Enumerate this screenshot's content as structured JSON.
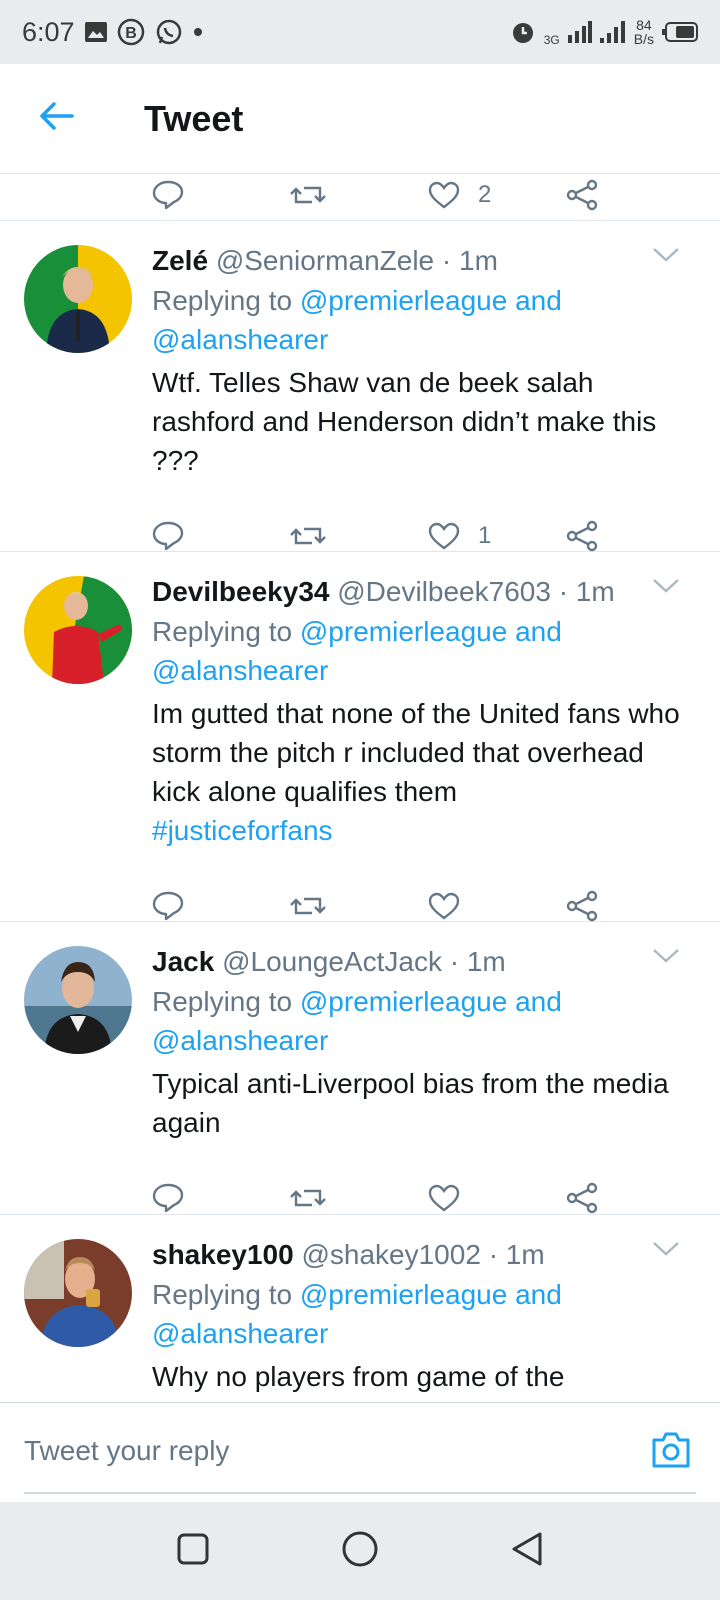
{
  "status_bar": {
    "time": "6:07",
    "network": "3G",
    "speed_value": "84",
    "speed_unit": "B/s"
  },
  "header": {
    "title": "Tweet"
  },
  "tweets": [
    {
      "name": "Zelé",
      "handle": "@SeniormanZele",
      "time": "· 1m",
      "reply_prefix": "Replying to",
      "reply_to_1": "@premierleague and",
      "reply_to_2": "@alanshearer",
      "text": "Wtf. Telles Shaw van de beek salah rashford and Henderson didn’t make this ???",
      "likes": "1"
    },
    {
      "name": "Devilbeeky34",
      "handle": "@Devilbeek7603",
      "time": "· 1m",
      "reply_prefix": "Replying to",
      "reply_to_1": "@premierleague and",
      "reply_to_2": "@alanshearer",
      "text": "Im gutted that none of the United fans who storm the pitch r included that overhead kick alone qualifies them",
      "hashtag": "#justiceforfans",
      "likes": ""
    },
    {
      "name": "Jack",
      "handle": "@LoungeActJack",
      "time": "· 1m",
      "reply_prefix": "Replying to",
      "reply_to_1": "@premierleague and",
      "reply_to_2": "@alanshearer",
      "text": "Typical anti-Liverpool bias from the media again",
      "likes": ""
    },
    {
      "name": "shakey100",
      "handle": "@shakey1002",
      "time": "· 1m",
      "reply_prefix": "Replying to",
      "reply_to_1": "@premierleague and",
      "reply_to_2": "@alanshearer",
      "text": "Why no players from game of the",
      "likes": ""
    }
  ],
  "partial_tweet": {
    "likes": "2"
  },
  "composer": {
    "placeholder": "Tweet your reply"
  },
  "icons": {
    "back": "back-arrow-icon",
    "reply": "reply-icon",
    "retweet": "retweet-icon",
    "like": "heart-icon",
    "share": "share-icon",
    "caret": "chevron-down-icon",
    "camera": "camera-icon"
  },
  "colors": {
    "accent": "#1da1f2",
    "secondary_text": "#657786",
    "primary_text": "#14171a",
    "divider": "#e1e8ed"
  }
}
